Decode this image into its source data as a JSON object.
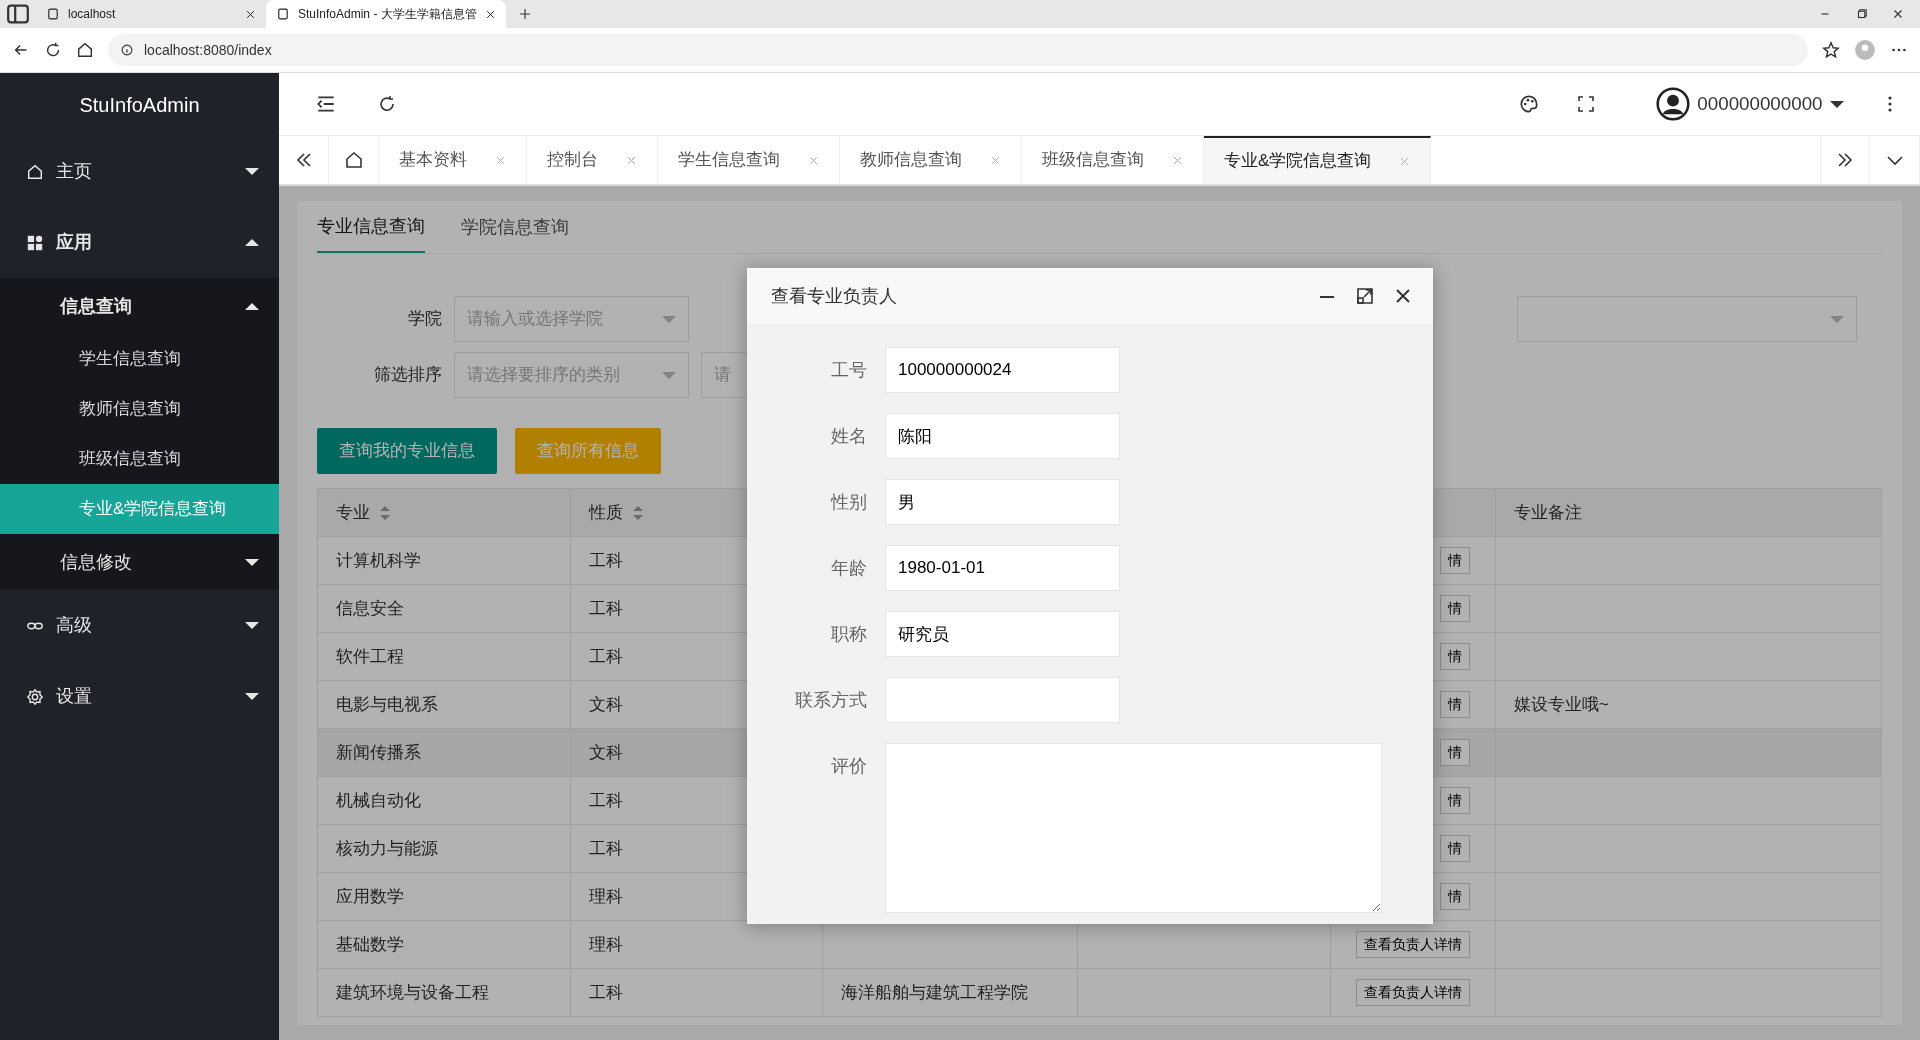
{
  "browser": {
    "tabs": [
      {
        "title": "localhost",
        "selected": false
      },
      {
        "title": "StuInfoAdmin - 大学生学籍信息管",
        "selected": true
      }
    ],
    "address": "localhost:8080/index"
  },
  "app": {
    "brand": "StuInfoAdmin",
    "user": "000000000000"
  },
  "sidebar": {
    "items": [
      {
        "label": "主页",
        "expanded": false
      },
      {
        "label": "应用",
        "expanded": true,
        "children": [
          {
            "label": "信息查询",
            "expanded": true,
            "children": [
              {
                "label": "学生信息查询",
                "selected": false
              },
              {
                "label": "教师信息查询",
                "selected": false
              },
              {
                "label": "班级信息查询",
                "selected": false
              },
              {
                "label": "专业&学院信息查询",
                "selected": true
              }
            ]
          },
          {
            "label": "信息修改",
            "expanded": false
          }
        ]
      },
      {
        "label": "高级",
        "expanded": false
      },
      {
        "label": "设置",
        "expanded": false
      }
    ]
  },
  "page_tabs": [
    {
      "label": "基本资料",
      "selected": false
    },
    {
      "label": "控制台",
      "selected": false
    },
    {
      "label": "学生信息查询",
      "selected": false
    },
    {
      "label": "教师信息查询",
      "selected": false
    },
    {
      "label": "班级信息查询",
      "selected": false
    },
    {
      "label": "专业&学院信息查询",
      "selected": true
    }
  ],
  "sub_tabs": [
    {
      "label": "专业信息查询",
      "selected": true
    },
    {
      "label": "学院信息查询",
      "selected": false
    }
  ],
  "filters": [
    {
      "label": "学院",
      "selects": [
        {
          "kind": "select",
          "placeholder": "请输入或选择学院"
        },
        {
          "kind": "select"
        }
      ]
    },
    {
      "label": "筛选排序",
      "selects": [
        {
          "kind": "select",
          "placeholder": "请选择要排序的类别"
        },
        {
          "kind": "select",
          "placeholder": "请"
        }
      ]
    }
  ],
  "actions": [
    {
      "label": "查询我的专业信息",
      "kind": "primary"
    },
    {
      "label": "查询所有信息",
      "kind": "warning"
    }
  ],
  "table": {
    "columns": {
      "major": {
        "label": "专业",
        "sortable": true
      },
      "nature": {
        "label": "性质",
        "sortable": true
      },
      "remark": {
        "label": "专业备注"
      }
    },
    "rows": [
      {
        "major": "计算机科学",
        "nature": "工科",
        "button": "情",
        "highlighted": false
      },
      {
        "major": "信息安全",
        "nature": "工科",
        "button": "情",
        "highlighted": false
      },
      {
        "major": "软件工程",
        "nature": "工科",
        "button": "情",
        "highlighted": false
      },
      {
        "major": "电影与电视系",
        "nature": "文科",
        "button": "情",
        "remark": "媒设专业哦~",
        "highlighted": false
      },
      {
        "major": "新闻传播系",
        "nature": "文科",
        "button": "情",
        "highlighted": true
      },
      {
        "major": "机械自动化",
        "nature": "工科",
        "button": "情",
        "highlighted": false
      },
      {
        "major": "核动力与能源",
        "nature": "工科",
        "button": "情",
        "highlighted": false
      },
      {
        "major": "应用数学",
        "nature": "理科",
        "button": "情",
        "highlighted": false
      },
      {
        "major": "基础数学",
        "nature": "理科",
        "button": "查看负责人详情",
        "highlighted": false
      },
      {
        "major": "建筑环境与设备工程",
        "nature": "工科",
        "college": "海洋船舶与建筑工程学院",
        "button": "查看负责人详情",
        "highlighted": false
      }
    ]
  },
  "modal": {
    "title": "查看专业负责人",
    "fields": [
      {
        "label": "工号",
        "value": "100000000024",
        "kind": "input"
      },
      {
        "label": "姓名",
        "value": "陈阳",
        "kind": "input"
      },
      {
        "label": "性别",
        "value": "男",
        "kind": "input"
      },
      {
        "label": "年龄",
        "value": "1980-01-01",
        "kind": "input"
      },
      {
        "label": "职称",
        "value": "研究员",
        "kind": "input"
      },
      {
        "label": "联系方式",
        "kind": "input"
      },
      {
        "label": "评价",
        "kind": "textarea"
      }
    ]
  }
}
